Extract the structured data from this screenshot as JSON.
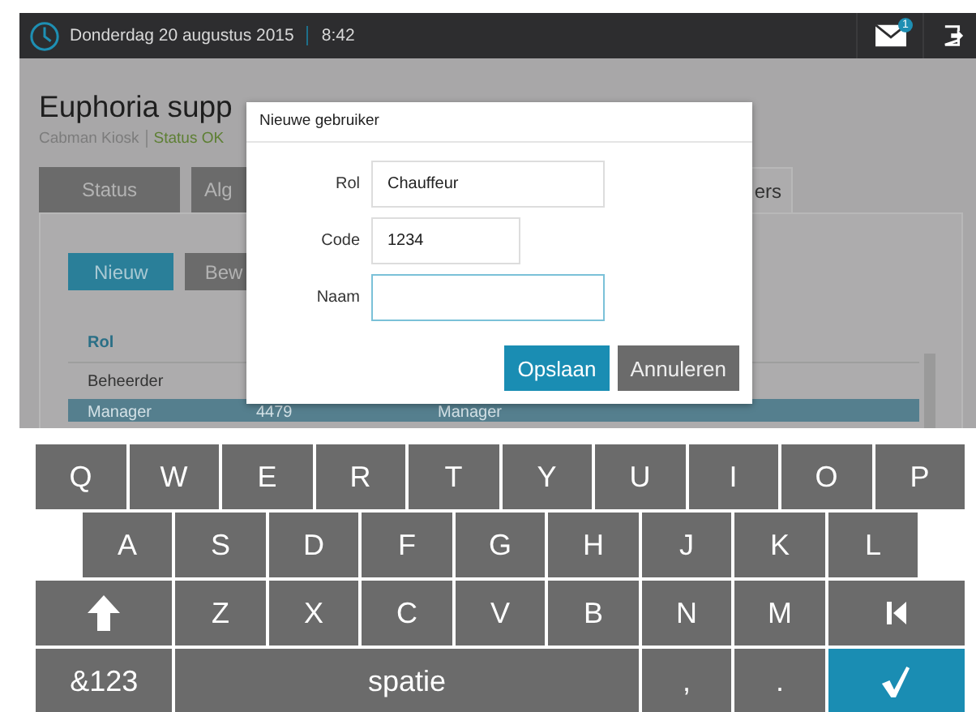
{
  "top_bar": {
    "date": "Donderdag 20 augustus 2015",
    "time": "8:42",
    "mail_badge": "1"
  },
  "page": {
    "title": "Euphoria supp",
    "subtitle": "Cabman Kiosk",
    "status": "Status OK",
    "tabs": [
      {
        "label": "Status",
        "selected": false
      },
      {
        "label": "Alg",
        "selected": false
      },
      {
        "label": "ers",
        "selected": true
      }
    ],
    "buttons": [
      {
        "label": "Nieuw",
        "kind": "primary"
      },
      {
        "label": "Bew",
        "kind": "secondary"
      }
    ],
    "table": {
      "columns": [
        "Rol"
      ],
      "rows": [
        {
          "cells": [
            "Beheerder"
          ],
          "selected": false
        },
        {
          "cells": [
            "Manager",
            "4479",
            "Manager"
          ],
          "selected": true
        }
      ]
    }
  },
  "dialog": {
    "title": "Nieuwe gebruiker",
    "fields": [
      {
        "label": "Rol",
        "value": "Chauffeur",
        "kind": "wide",
        "focused": false
      },
      {
        "label": "Code",
        "value": "1234",
        "kind": "narrow",
        "focused": false
      },
      {
        "label": "Naam",
        "kind": "wide",
        "focused": true
      }
    ],
    "buttons": [
      {
        "label": "Opslaan",
        "kind": "primary"
      },
      {
        "label": "Annuleren",
        "kind": "secondary"
      }
    ]
  },
  "keyboard": [
    [
      {
        "label": "Q",
        "kind": "letter"
      },
      {
        "label": "W",
        "kind": "letter"
      },
      {
        "label": "E",
        "kind": "letter"
      },
      {
        "label": "R",
        "kind": "letter"
      },
      {
        "label": "T",
        "kind": "letter"
      },
      {
        "label": "Y",
        "kind": "letter"
      },
      {
        "label": "U",
        "kind": "letter"
      },
      {
        "label": "I",
        "kind": "letter"
      },
      {
        "label": "O",
        "kind": "letter"
      },
      {
        "label": "P",
        "kind": "letter"
      }
    ],
    [
      {
        "label": "A",
        "kind": "letter"
      },
      {
        "label": "S",
        "kind": "letter"
      },
      {
        "label": "D",
        "kind": "letter"
      },
      {
        "label": "F",
        "kind": "letter"
      },
      {
        "label": "G",
        "kind": "letter"
      },
      {
        "label": "H",
        "kind": "letter"
      },
      {
        "label": "J",
        "kind": "letter"
      },
      {
        "label": "K",
        "kind": "letter"
      },
      {
        "label": "L",
        "kind": "letter"
      }
    ],
    [
      {
        "kind": "shift"
      },
      {
        "label": "Z",
        "kind": "letter"
      },
      {
        "label": "X",
        "kind": "letter"
      },
      {
        "label": "C",
        "kind": "letter"
      },
      {
        "label": "V",
        "kind": "letter"
      },
      {
        "label": "B",
        "kind": "letter"
      },
      {
        "label": "N",
        "kind": "letter"
      },
      {
        "label": "M",
        "kind": "letter"
      },
      {
        "kind": "backspace"
      }
    ],
    [
      {
        "label": "&123",
        "kind": "symbols"
      },
      {
        "label": "spatie",
        "kind": "space"
      },
      {
        "label": ",",
        "kind": "letter"
      },
      {
        "label": ".",
        "kind": "letter"
      },
      {
        "kind": "enter"
      }
    ]
  ]
}
